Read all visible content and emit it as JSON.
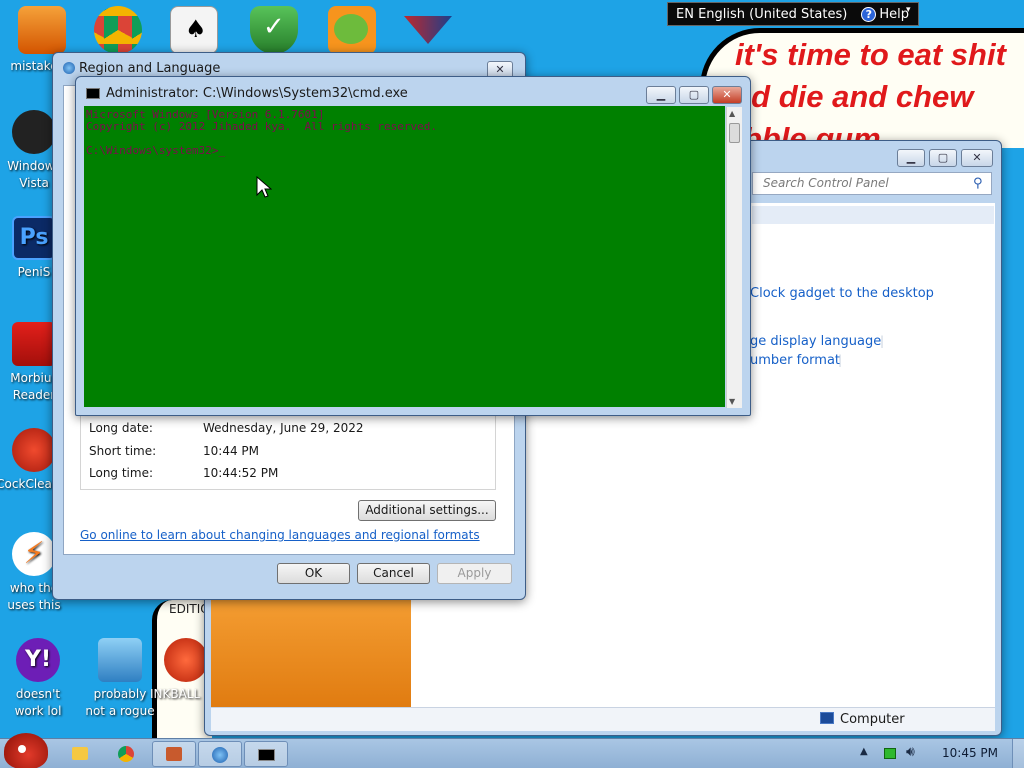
{
  "language_bar": {
    "language": "EN English (United States)",
    "help_label": "Help"
  },
  "wallpaper": {
    "line1": "it's time to eat shit",
    "line2": "and die and chew",
    "line3": "bubble gum",
    "fragment_left": "EDITIO"
  },
  "desktop_icons": [
    {
      "label": "mistake"
    },
    {
      "label": "Windows Vista"
    },
    {
      "label": "PeniS"
    },
    {
      "label": "Morbius Reader"
    },
    {
      "label": "CockCleaner"
    },
    {
      "label": "who the uses this"
    },
    {
      "label": "doesn't work lol"
    },
    {
      "label": "probably not a rogue"
    },
    {
      "label": "INKBALL"
    }
  ],
  "region_dialog": {
    "title": "Region and Language",
    "close_glyph": "✕",
    "formats": [
      {
        "label": "Long date:",
        "value": "Wednesday, June 29, 2022"
      },
      {
        "label": "Short time:",
        "value": "10:44 PM"
      },
      {
        "label": "Long time:",
        "value": "10:44:52 PM"
      }
    ],
    "additional_settings": "Additional settings...",
    "online_link": "Go online to learn about changing languages and regional formats",
    "ok": "OK",
    "cancel": "Cancel",
    "apply": "Apply"
  },
  "cmd_window": {
    "title": "Administrator: C:\\Windows\\System32\\cmd.exe",
    "line1": "Microsoft Windows [Version 6.1.7601]",
    "line2": "Copyright (c) 2012 Jihaded kya.  All rights reserved.",
    "prompt": "C:\\Windows\\system32>_",
    "background_color": "#008000",
    "text_color": "#7f0a4e"
  },
  "control_panel": {
    "search_placeholder": "Search Control Panel",
    "link_clock": "Clock gadget to the desktop",
    "link_display_language": "ge display language",
    "link_number_format": "umber format",
    "status_computer": "Computer"
  },
  "taskbar": {
    "clock": "10:45 PM",
    "show_hidden_glyph": "▲"
  }
}
